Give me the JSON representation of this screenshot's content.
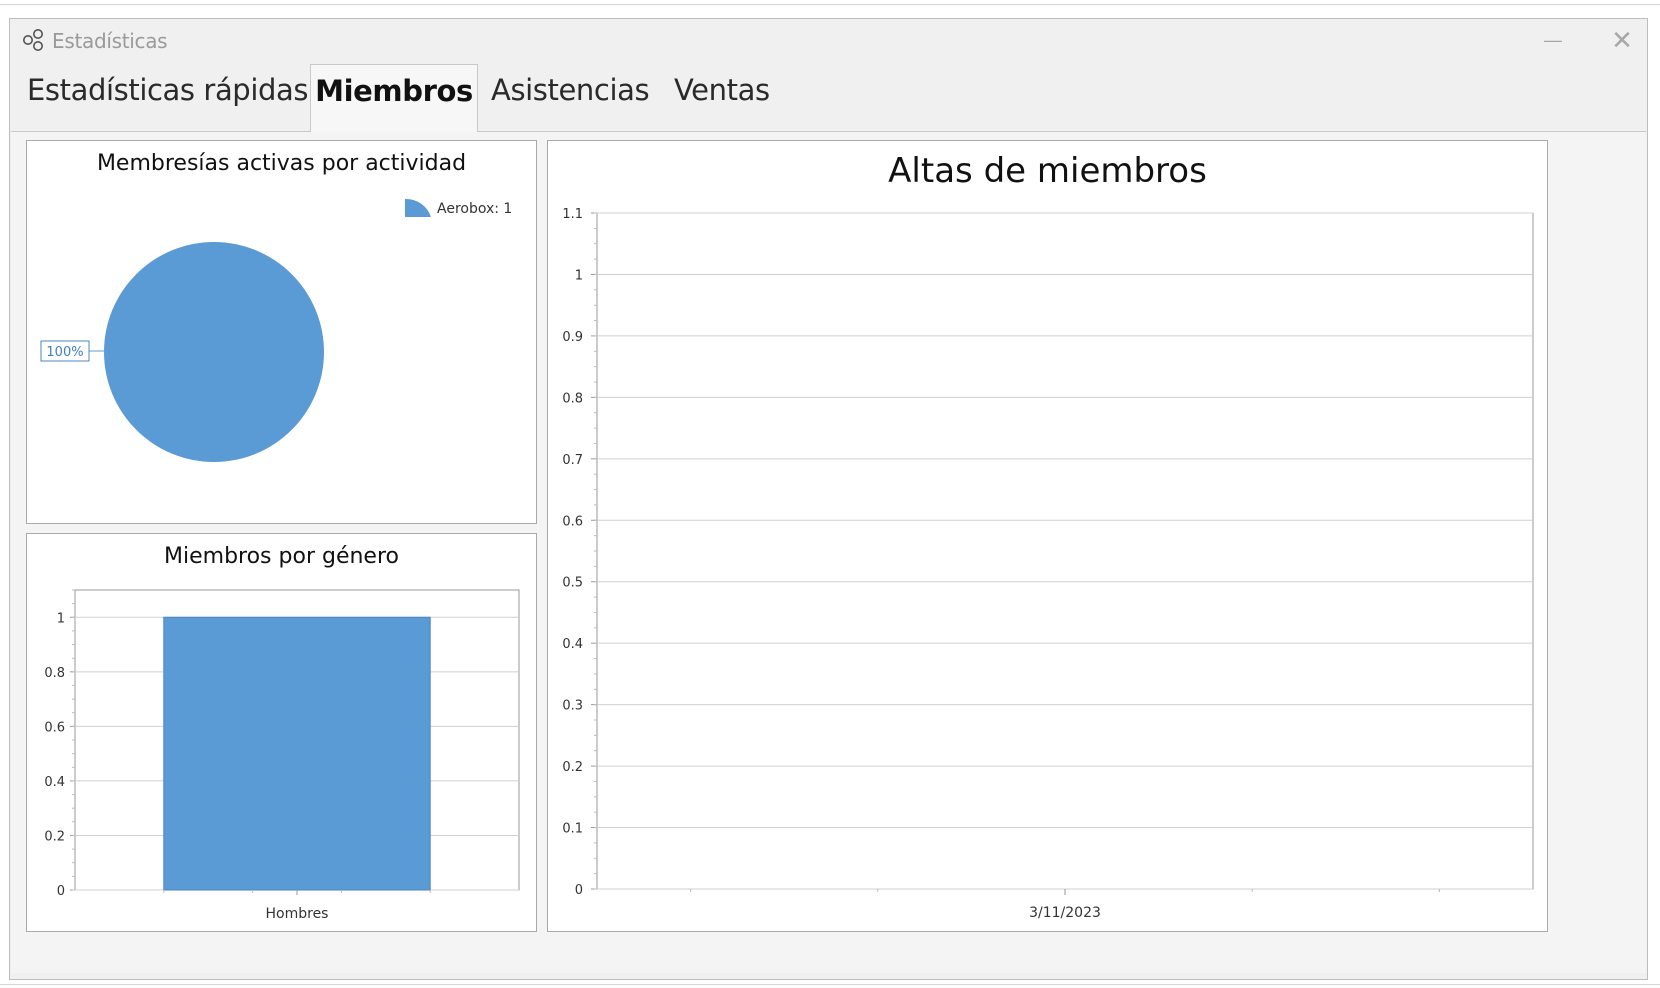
{
  "window": {
    "title": "Estadísticas",
    "minimize_glyph": "—",
    "close_glyph": "✕",
    "icon": "network-nodes-icon"
  },
  "tabs": [
    {
      "label": "Estadísticas rápidas",
      "active": false
    },
    {
      "label": "Miembros",
      "active": true
    },
    {
      "label": "Asistencias",
      "active": false
    },
    {
      "label": "Ventas",
      "active": false
    }
  ],
  "colors": {
    "series": "#5b9bd5",
    "series_border": "#4a86c5",
    "grid": "#d0d0d0",
    "axis": "#9a9a9a"
  },
  "chart_data": [
    {
      "id": "activity",
      "type": "pie",
      "title": "Membresías activas por actividad",
      "slices": [
        {
          "label": "Aerobox",
          "value": 1,
          "percent": 100
        }
      ],
      "legend": [
        "Aerobox: 1"
      ],
      "data_labels": [
        "100%"
      ],
      "legend_position": "top-right"
    },
    {
      "id": "gender",
      "type": "bar",
      "title": "Miembros por género",
      "categories": [
        "Hombres"
      ],
      "values": [
        1
      ],
      "ylim": [
        0,
        1.1
      ],
      "yticks": [
        "0",
        "0.2",
        "0.4",
        "0.6",
        "0.8",
        "1"
      ],
      "grid": true
    },
    {
      "id": "signups",
      "type": "line",
      "title": "Altas de miembros",
      "x": [
        "3/11/2023"
      ],
      "values": [],
      "ylim": [
        0,
        1.1
      ],
      "yticks": [
        "0",
        "0.1",
        "0.2",
        "0.3",
        "0.4",
        "0.5",
        "0.6",
        "0.7",
        "0.8",
        "0.9",
        "1",
        "1.1"
      ],
      "grid": true
    }
  ]
}
